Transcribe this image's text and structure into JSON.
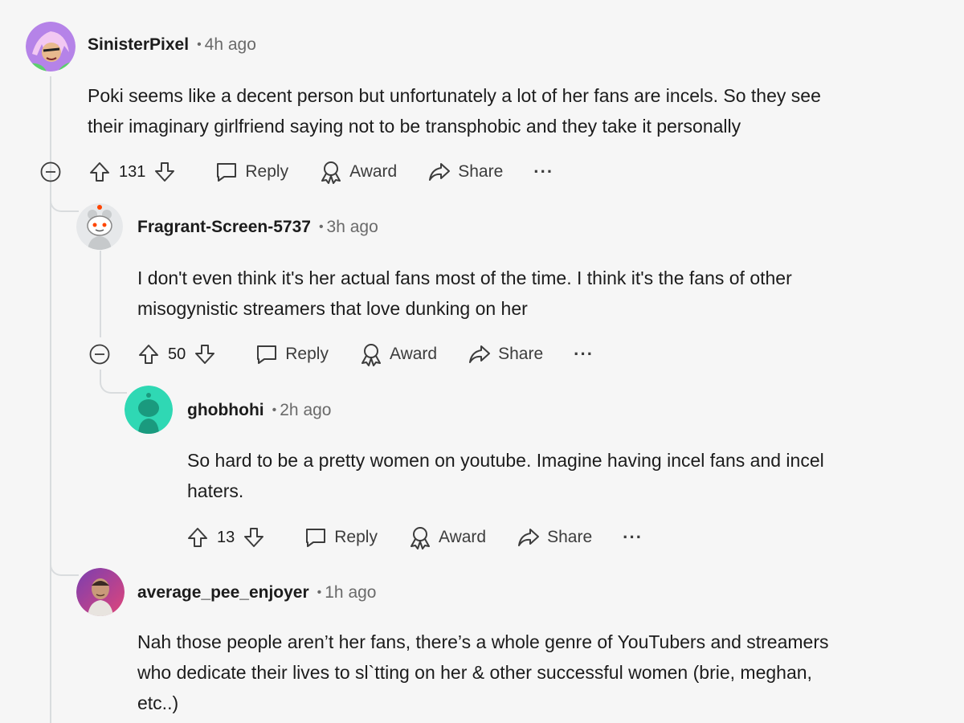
{
  "comments": [
    {
      "username": "SinisterPixel",
      "time": "4h ago",
      "lines": [
        "Poki seems like a decent person but unfortunately a lot of her fans are incels. So they see",
        "their imaginary girlfriend saying not to be transphobic and they take it personally"
      ],
      "votes": "131",
      "avatar_color": "#b583e8"
    },
    {
      "username": "Fragrant-Screen-5737",
      "time": "3h ago",
      "lines": [
        "I don't even think it's her actual fans most of the time. I think it's the fans of other",
        "misogynistic streamers that love dunking on her"
      ],
      "votes": "50",
      "avatar_color": "#d7dadc"
    },
    {
      "username": "ghobhohi",
      "time": "2h ago",
      "lines": [
        "So hard to be a pretty women on youtube. Imagine having incel fans and incel",
        "haters."
      ],
      "votes": "13",
      "avatar_color": "#2fd8b4"
    },
    {
      "username": "average_pee_enjoyer",
      "time": "1h ago",
      "lines": [
        "Nah those people aren’t her fans, there’s a whole genre of YouTubers and streamers",
        "who dedicate their lives to sl`tting on her & other successful women (brie, meghan,",
        "etc..)"
      ],
      "avatar_color": "#a0406a"
    }
  ],
  "actions": {
    "reply": "Reply",
    "award": "Award",
    "share": "Share",
    "more": "···"
  },
  "colors": {
    "background": "#f6f6f6",
    "text": "#1c1c1c",
    "muted": "#6a6a6a",
    "thread_line": "#d9dcde"
  },
  "icons": [
    "upvote-icon",
    "downvote-icon",
    "reply-icon",
    "award-icon",
    "share-icon",
    "collapse-icon",
    "more-icon"
  ]
}
